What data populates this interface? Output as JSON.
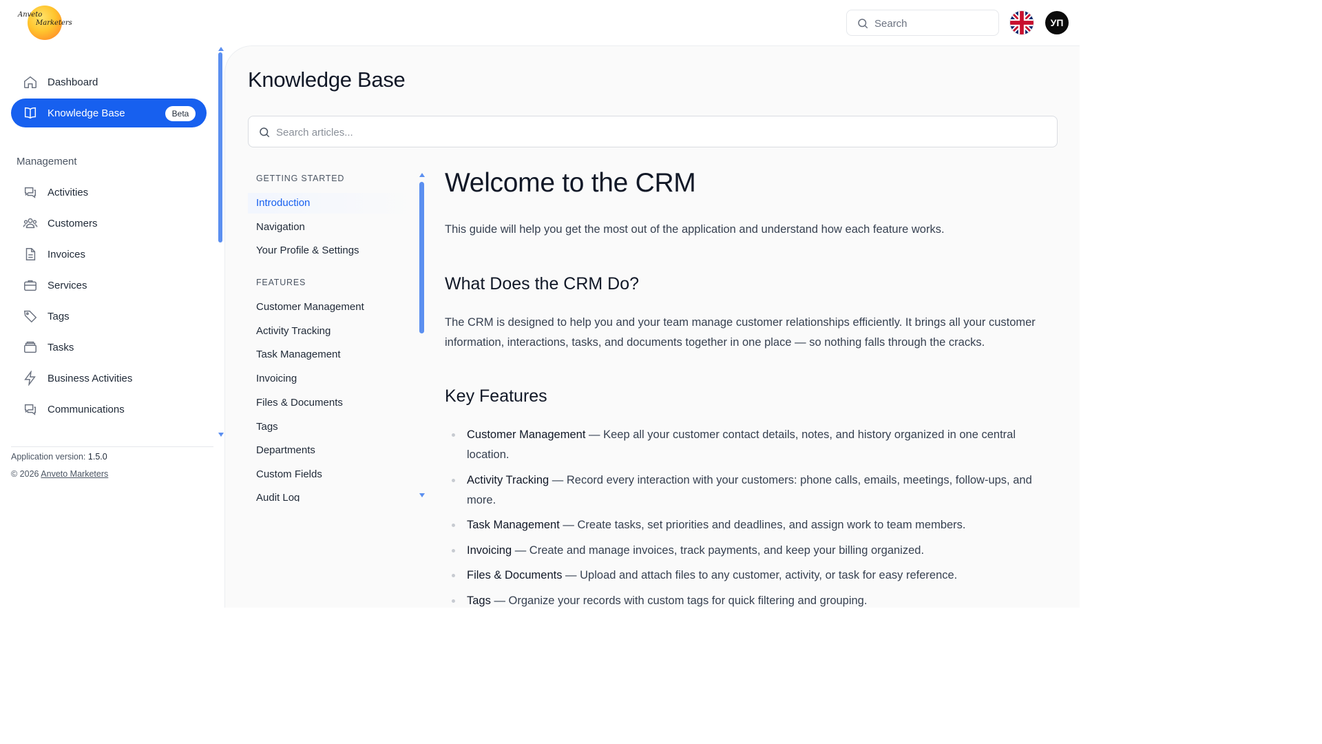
{
  "header": {
    "logo_text_line1": "Anveto",
    "logo_text_line2": "Marketers",
    "search_placeholder": "Search",
    "avatar_initials": "УП"
  },
  "sidebar": {
    "top_items": [
      {
        "label": "Dashboard",
        "icon": "home-icon"
      },
      {
        "label": "Knowledge Base",
        "icon": "book-icon",
        "badge": "Beta",
        "active": true
      }
    ],
    "section_label": "Management",
    "management_items": [
      {
        "label": "Activities",
        "icon": "chat-bubbles-icon"
      },
      {
        "label": "Customers",
        "icon": "users-icon"
      },
      {
        "label": "Invoices",
        "icon": "document-icon"
      },
      {
        "label": "Services",
        "icon": "briefcase-icon"
      },
      {
        "label": "Tags",
        "icon": "tag-icon"
      },
      {
        "label": "Tasks",
        "icon": "archive-box-icon"
      },
      {
        "label": "Business Activities",
        "icon": "bolt-icon"
      },
      {
        "label": "Communications",
        "icon": "chat-bubbles-icon"
      }
    ],
    "version_label": "Application version:",
    "version_value": "1.5.0",
    "copyright_prefix": "© 2026",
    "copyright_link": "Anveto Marketers"
  },
  "main": {
    "title": "Knowledge Base",
    "search_placeholder": "Search articles...",
    "toc": {
      "sections": [
        {
          "heading": "GETTING STARTED",
          "items": [
            "Introduction",
            "Navigation",
            "Your Profile & Settings"
          ]
        },
        {
          "heading": "FEATURES",
          "items": [
            "Customer Management",
            "Activity Tracking",
            "Task Management",
            "Invoicing",
            "Files & Documents",
            "Tags",
            "Departments",
            "Custom Fields",
            "Audit Log"
          ]
        }
      ],
      "active_item": "Introduction"
    },
    "article": {
      "title": "Welcome to the CRM",
      "intro": "This guide will help you get the most out of the application and understand how each feature works.",
      "section1_title": "What Does the CRM Do?",
      "section1_body": "The CRM is designed to help you and your team manage customer relationships efficiently. It brings all your customer information, interactions, tasks, and documents together in one place — so nothing falls through the cracks.",
      "section2_title": "Key Features",
      "features": [
        {
          "name": "Customer Management",
          "desc": " — Keep all your customer contact details, notes, and history organized in one central location."
        },
        {
          "name": "Activity Tracking",
          "desc": " — Record every interaction with your customers: phone calls, emails, meetings, follow-ups, and more."
        },
        {
          "name": "Task Management",
          "desc": " — Create tasks, set priorities and deadlines, and assign work to team members."
        },
        {
          "name": "Invoicing",
          "desc": " — Create and manage invoices, track payments, and keep your billing organized."
        },
        {
          "name": "Files & Documents",
          "desc": " — Upload and attach files to any customer, activity, or task for easy reference."
        },
        {
          "name": "Tags",
          "desc": " — Organize your records with custom tags for quick filtering and grouping."
        }
      ]
    }
  },
  "colors": {
    "accent": "#1760ef",
    "scrollbar": "#5b8ff0",
    "text": "#1f2937"
  }
}
